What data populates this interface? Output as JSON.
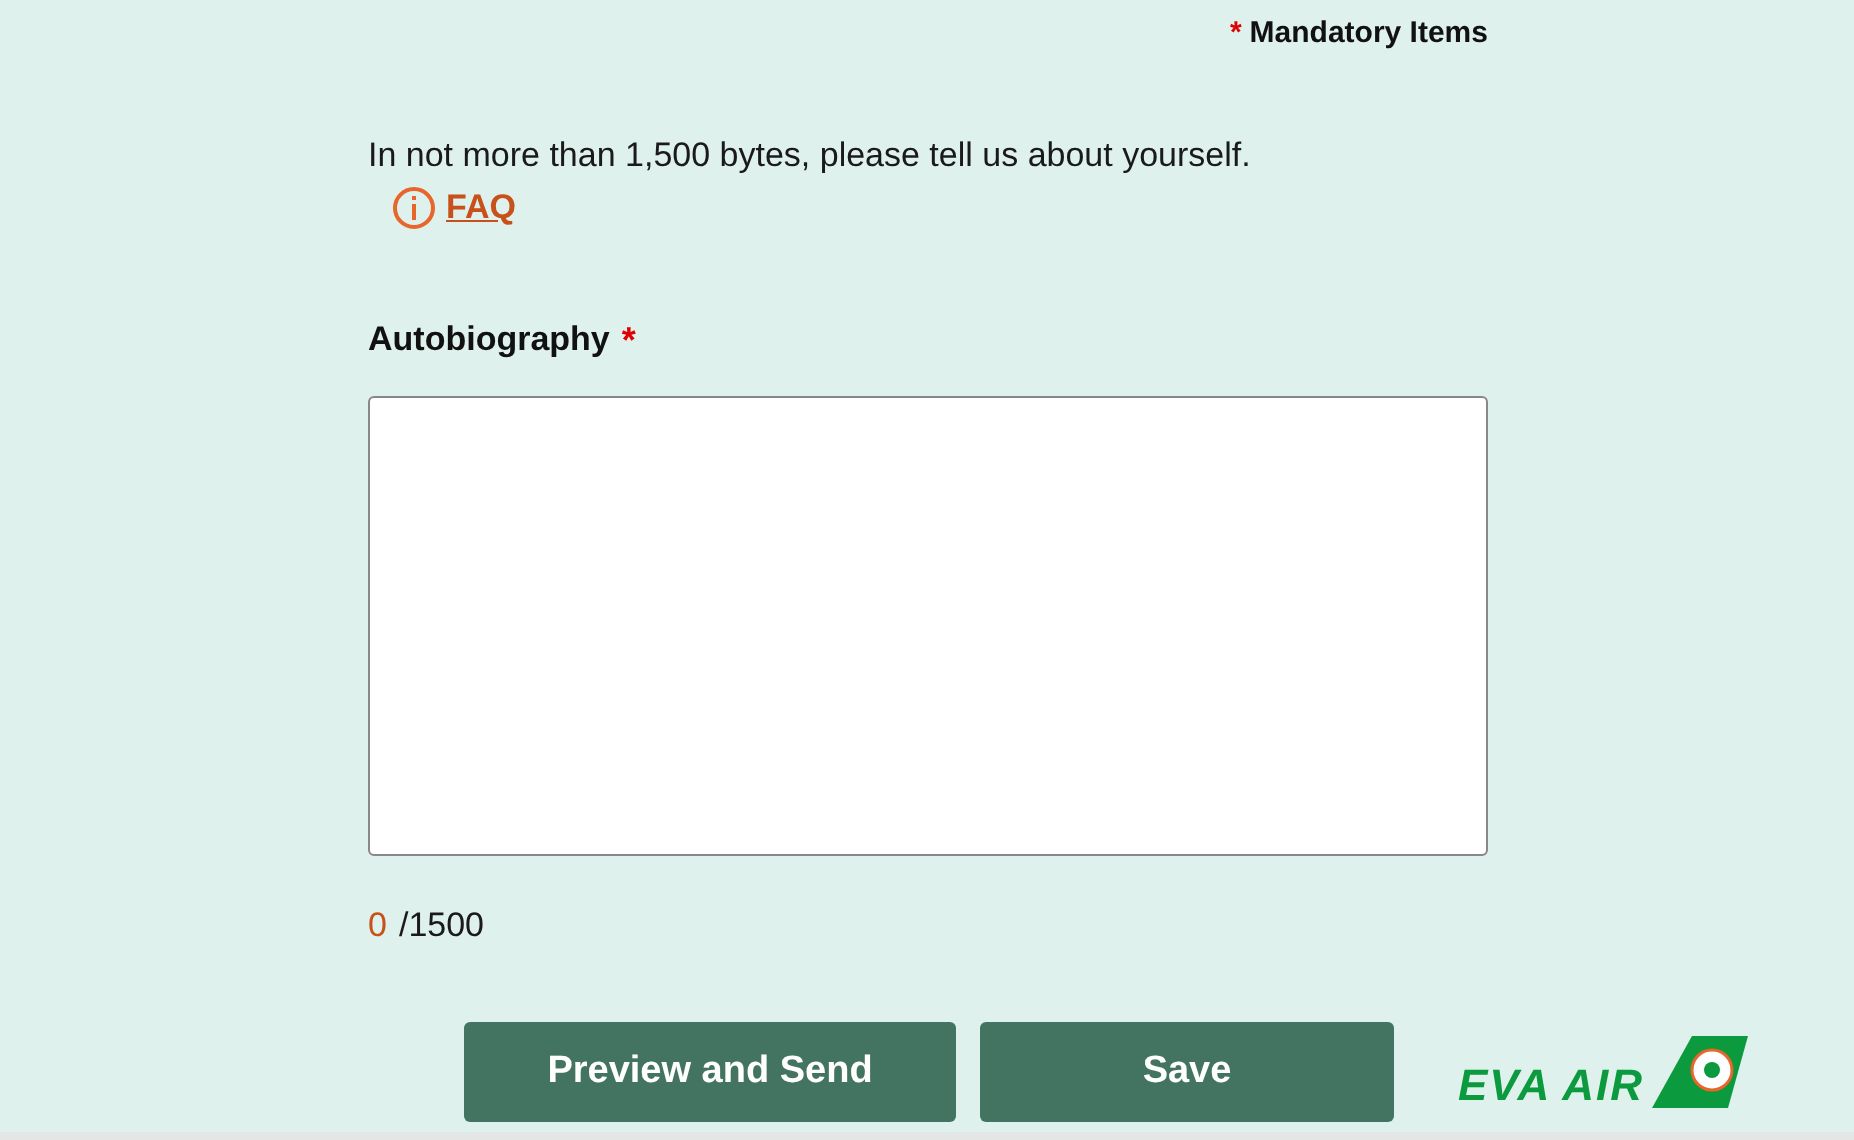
{
  "mandatory_note": {
    "mark": "*",
    "label": "Mandatory Items"
  },
  "intro": "In not more than 1,500 bytes, please tell us about yourself.",
  "faq_link": "FAQ",
  "field": {
    "label": "Autobiography",
    "required_mark": "*"
  },
  "counter": {
    "count": "0",
    "limit": "/1500"
  },
  "buttons": [
    "Preview and Send",
    "Save"
  ],
  "logo": {
    "text": "EVA AIR"
  }
}
